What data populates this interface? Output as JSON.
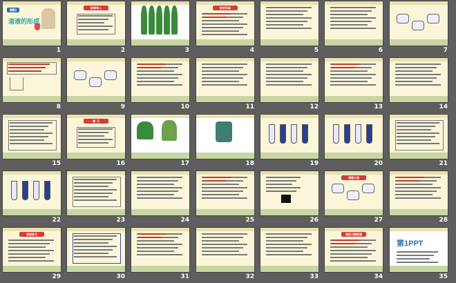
{
  "slides": [
    {
      "n": "1",
      "kind": "title",
      "chip": "课题1",
      "headline": "溶液的形成"
    },
    {
      "n": "2",
      "kind": "chip-table",
      "chip": "新课导入",
      "chip_color": "#d83a3a"
    },
    {
      "n": "3",
      "kind": "photo-plants"
    },
    {
      "n": "4",
      "kind": "chip-text",
      "chip": "教学目标",
      "chip_color": "#d83a3a"
    },
    {
      "n": "5",
      "kind": "text"
    },
    {
      "n": "6",
      "kind": "text"
    },
    {
      "n": "7",
      "kind": "diagram"
    },
    {
      "n": "8",
      "kind": "beaker"
    },
    {
      "n": "9",
      "kind": "diagram"
    },
    {
      "n": "10",
      "kind": "text"
    },
    {
      "n": "11",
      "kind": "text"
    },
    {
      "n": "12",
      "kind": "text"
    },
    {
      "n": "13",
      "kind": "text"
    },
    {
      "n": "14",
      "kind": "text"
    },
    {
      "n": "15",
      "kind": "table"
    },
    {
      "n": "16",
      "kind": "chip-table",
      "chip": "练 习",
      "chip_color": "#d83a3a"
    },
    {
      "n": "17",
      "kind": "photo-plants2"
    },
    {
      "n": "18",
      "kind": "photo-bottle"
    },
    {
      "n": "19",
      "kind": "tubes"
    },
    {
      "n": "20",
      "kind": "tubes2"
    },
    {
      "n": "21",
      "kind": "table"
    },
    {
      "n": "22",
      "kind": "tubes3"
    },
    {
      "n": "23",
      "kind": "table"
    },
    {
      "n": "24",
      "kind": "text"
    },
    {
      "n": "25",
      "kind": "text"
    },
    {
      "n": "26",
      "kind": "text-dark"
    },
    {
      "n": "27",
      "kind": "chip-diagram",
      "chip": "课堂小结",
      "chip_color": "#d83a3a"
    },
    {
      "n": "28",
      "kind": "text"
    },
    {
      "n": "29",
      "kind": "chip-text",
      "chip": "课堂练习",
      "chip_color": "#d83a3a"
    },
    {
      "n": "30",
      "kind": "table-blue"
    },
    {
      "n": "31",
      "kind": "text"
    },
    {
      "n": "32",
      "kind": "text"
    },
    {
      "n": "33",
      "kind": "text"
    },
    {
      "n": "34",
      "kind": "chip-text",
      "chip": "课后习题答案",
      "chip_color": "#d83a3a"
    },
    {
      "n": "35",
      "kind": "ppt-logo",
      "logo": "第1PPT"
    }
  ]
}
